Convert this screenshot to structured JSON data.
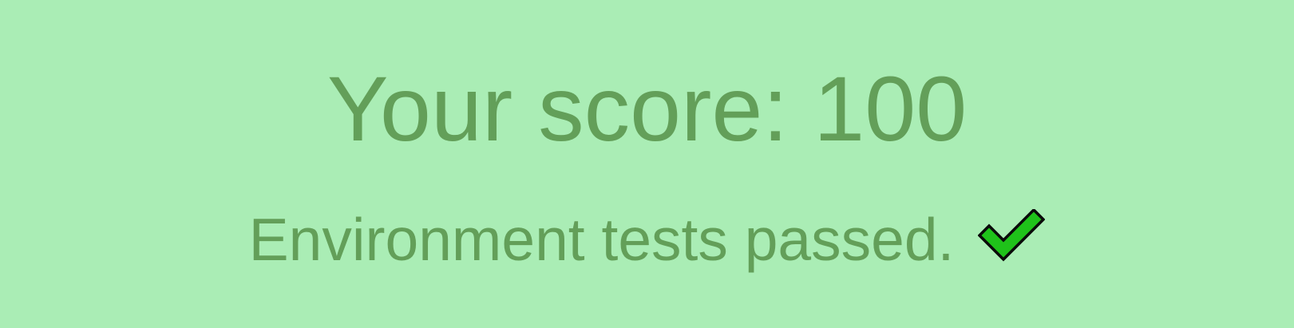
{
  "score": {
    "label": "Your score:",
    "value": "100"
  },
  "status": {
    "message": "Environment tests passed.",
    "icon": "checkmark-icon"
  },
  "colors": {
    "background": "#aaedb5",
    "text": "#639f59",
    "check_fill": "#1fc21a",
    "check_stroke": "#0a0a0a"
  }
}
